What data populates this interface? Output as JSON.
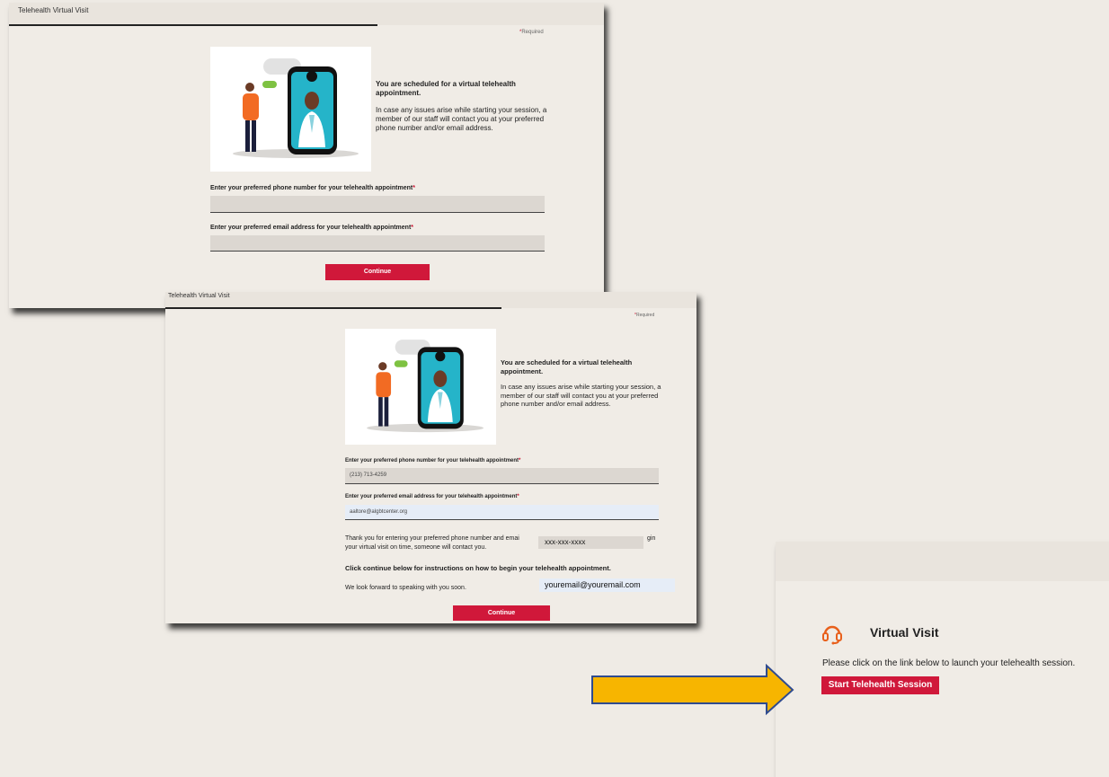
{
  "window_back": {
    "title": "Telehealth Virtual Visit",
    "required_text": "Required",
    "heading": "You are scheduled for a virtual telehealth appointment.",
    "body": "In case any issues arise while starting your session, a member of our staff will contact you at your preferred phone number and/or email address.",
    "phone_label": "Enter your preferred phone number for your telehealth appointment",
    "phone_value": "",
    "email_label": "Enter your preferred email address for your telehealth appointment",
    "email_value": "",
    "continue_label": "Continue"
  },
  "window_front": {
    "title": "Telehealth Virtual Visit",
    "required_text": "Required",
    "heading": "You are scheduled for a virtual telehealth appointment.",
    "body": "In case any issues arise while starting your session, a member of our staff will contact you at your preferred phone number and/or email address.",
    "phone_label": "Enter your preferred phone number for your telehealth appointment",
    "phone_value": "(213) 713-4259",
    "email_label": "Enter your preferred email address for your telehealth appointment",
    "email_value": "aaltore@algbtcenter.org",
    "thanks_part1": "Thank you for entering your preferred phone number and emai",
    "thanks_end": "gin",
    "thanks_line2": "your virtual visit on time, someone will contact you.",
    "instructions": "Click continue below for instructions on how to begin your telehealth appointment.",
    "look_forward": "We look forward to speaking with you soon.",
    "continue_label": "Continue"
  },
  "overlays": {
    "phone_placeholder": "xxx-xxx-xxxx",
    "email_placeholder": "youremail@youremail.com"
  },
  "virtual_visit": {
    "title": "Virtual Visit",
    "description": "Please click on the link below to launch your telehealth session.",
    "start_button": "Start Telehealth Session"
  },
  "colors": {
    "accent_red": "#d0183a",
    "headset_orange": "#e8601c",
    "arrow_fill": "#f7b500",
    "arrow_outline": "#2f4b8f"
  },
  "icons": [
    "telehealth-illustration",
    "headset-icon",
    "arrow-pointer"
  ]
}
